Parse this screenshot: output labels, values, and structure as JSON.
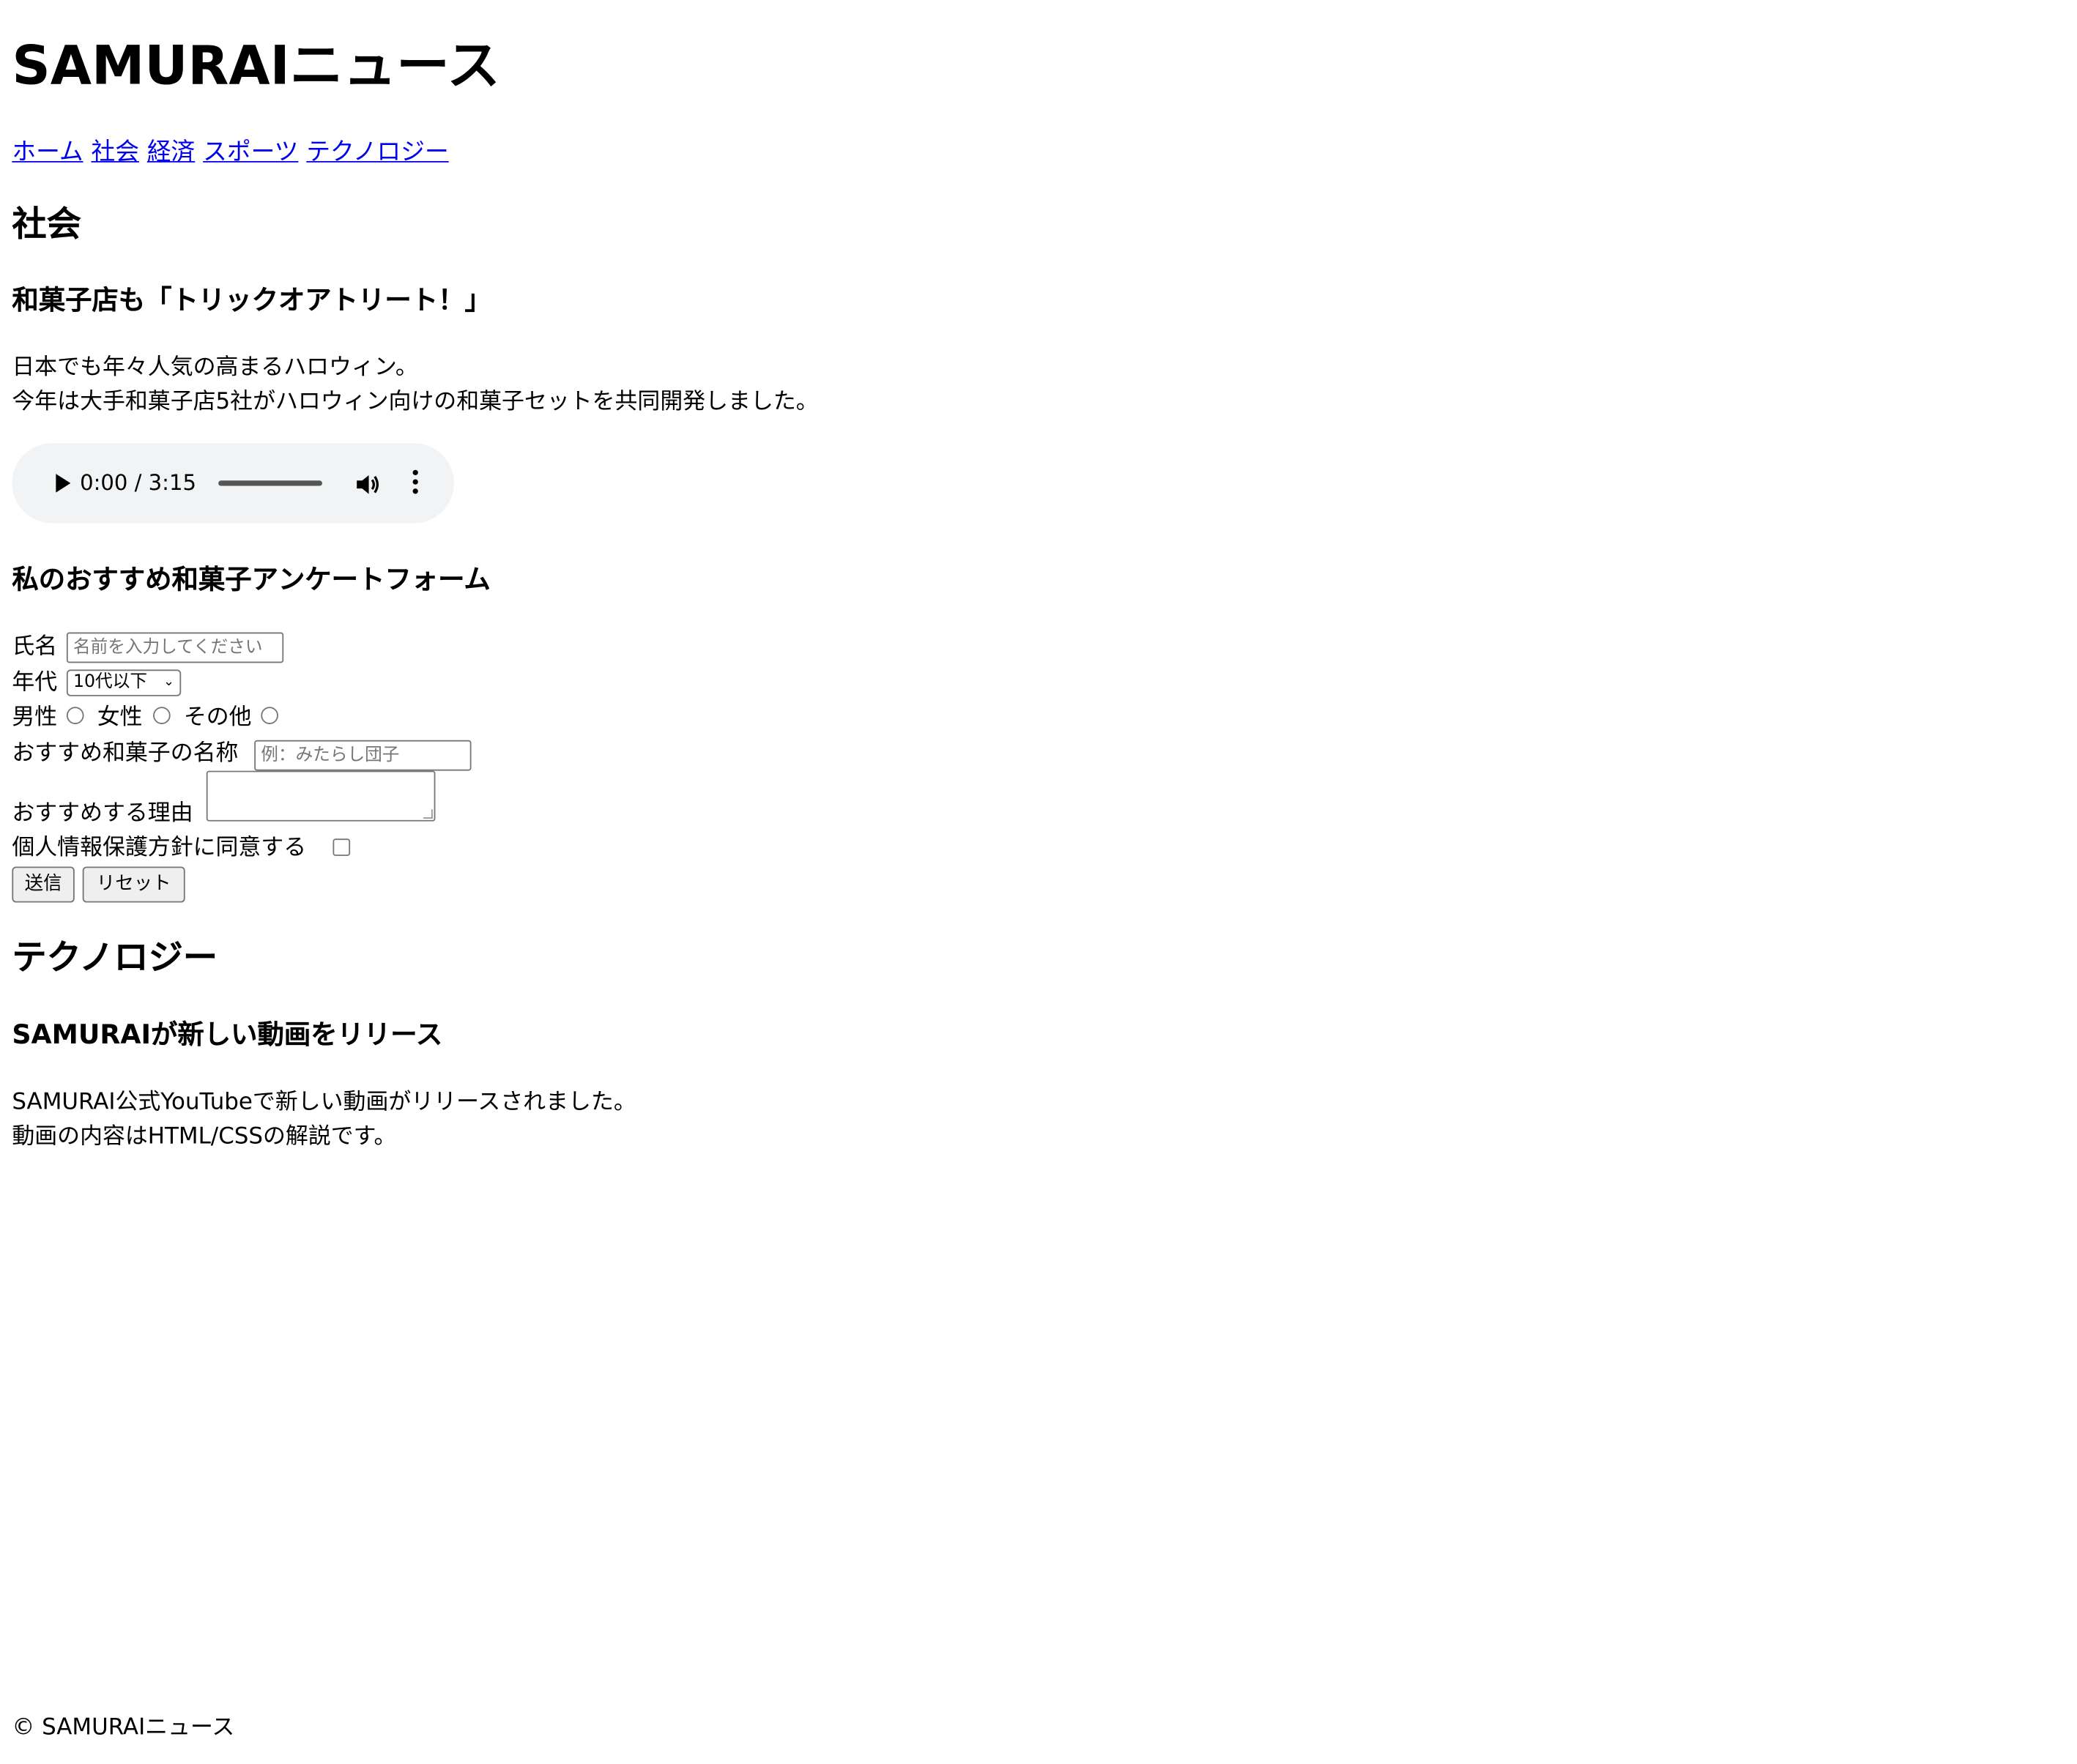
{
  "header": {
    "site_title": "SAMURAIニュース"
  },
  "nav": {
    "items": [
      "ホーム",
      "社会",
      "経済",
      "スポーツ",
      "テクノロジー"
    ]
  },
  "society": {
    "heading": "社会",
    "article_title": "和菓子店も「トリックオアトリート！」",
    "body_line1": "日本でも年々人気の高まるハロウィン。",
    "body_line2": "今年は大手和菓子店5社がハロウィン向けの和菓子セットを共同開発しました。",
    "audio": {
      "time": "0:00 / 3:15"
    }
  },
  "survey": {
    "title": "私のおすすめ和菓子アンケートフォーム",
    "name_label": "氏名",
    "name_placeholder": "名前を入力してください",
    "age_label": "年代",
    "age_selected": "10代以下",
    "gender_options": [
      "男性",
      "女性",
      "その他"
    ],
    "wagashi_label": "おすすめ和菓子の名称",
    "wagashi_placeholder": "例：みたらし団子",
    "reason_label": "おすすめする理由",
    "privacy_label": "個人情報保護方針に同意する",
    "submit_label": "送信",
    "reset_label": "リセット"
  },
  "technology": {
    "heading": "テクノロジー",
    "article_title": "SAMURAIが新しい動画をリリース",
    "body_line1": "SAMURAI公式YouTubeで新しい動画がリリースされました。",
    "body_line2": "動画の内容はHTML/CSSの解説です。"
  },
  "footer": {
    "copyright": "© SAMURAIニュース"
  }
}
